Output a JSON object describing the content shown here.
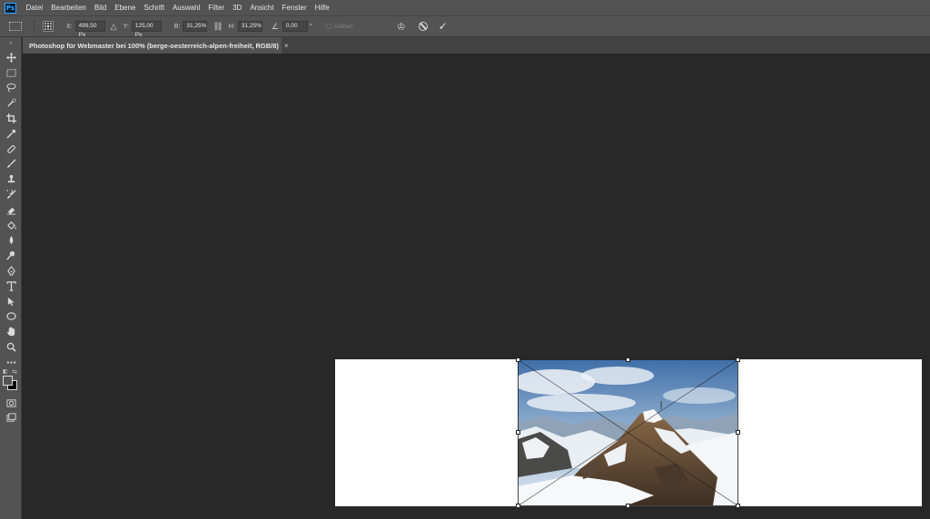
{
  "app": {
    "logo_text": "Ps"
  },
  "menu": [
    "Datei",
    "Bearbeiten",
    "Bild",
    "Ebene",
    "Schrift",
    "Auswahl",
    "Filter",
    "3D",
    "Ansicht",
    "Fenster",
    "Hilfe"
  ],
  "options": {
    "x_label": "X:",
    "x_value": "499,50 Px",
    "y_label": "Y:",
    "y_value": "125,00 Px",
    "w_label": "B:",
    "w_value": "31,25%",
    "h_label": "H:",
    "h_value": "31,25%",
    "angle_value": "0,00",
    "angle_unit": "°",
    "smoothing_label": "Glätten"
  },
  "document": {
    "tab_title": "Photoshop für Webmaster bei 100% (berge-oesterreich-alpen-freiheit, RGB/8)",
    "close_symbol": "×"
  },
  "toolbar": {
    "collapse_symbol": "»",
    "tools": [
      "move-tool",
      "rectangular-marquee-tool",
      "lasso-tool",
      "quick-selection-tool",
      "crop-tool",
      "eyedropper-tool",
      "healing-brush-tool",
      "brush-tool",
      "clone-stamp-tool",
      "history-brush-tool",
      "eraser-tool",
      "paint-bucket-tool",
      "blur-tool",
      "dodge-tool",
      "pen-tool",
      "type-tool",
      "path-selection-tool",
      "ellipse-tool",
      "hand-tool",
      "zoom-tool",
      "edit-toolbar"
    ],
    "foreground_color": "#535353",
    "background_color": "#000000"
  },
  "colors": {
    "ui_bg": "#535353",
    "workspace": "#282828",
    "canvas": "#ffffff",
    "accent": "#31a8ff"
  }
}
